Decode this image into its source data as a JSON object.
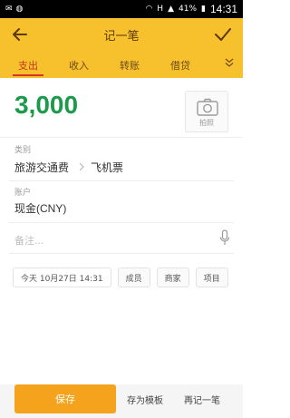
{
  "status_bar": {
    "icons": [
      "mail-icon",
      "wechat-icon",
      "wifi-icon",
      "alarm-icon",
      "signal-icon",
      "battery-icon"
    ],
    "network_label": "H",
    "battery_text": "41%",
    "time": "14:31"
  },
  "app_bar": {
    "title": "记一笔",
    "back_icon": "arrow-left-icon",
    "confirm_icon": "check-icon"
  },
  "tabs": [
    {
      "label": "支出",
      "active": true
    },
    {
      "label": "收入",
      "active": false
    },
    {
      "label": "转账",
      "active": false
    },
    {
      "label": "借贷",
      "active": false
    }
  ],
  "amount": {
    "value": "3,000",
    "color": "#1a9a4a"
  },
  "photo": {
    "label": "拍照",
    "icon": "camera-icon"
  },
  "category": {
    "label": "类别",
    "primary": "旅游交通费",
    "secondary": "飞机票"
  },
  "account": {
    "label": "账户",
    "value": "现金(CNY)"
  },
  "remark": {
    "placeholder": "备注...",
    "icon": "microphone-icon"
  },
  "chips": {
    "date": "今天 10月27日 14:31",
    "member": "成员",
    "merchant": "商家",
    "project": "项目"
  },
  "bottom": {
    "save": "保存",
    "save_template": "存为模板",
    "save_again": "再记一笔"
  },
  "colors": {
    "accent": "#f7c02d",
    "active_tab": "#c4371e",
    "save_button": "#f5a21d"
  }
}
